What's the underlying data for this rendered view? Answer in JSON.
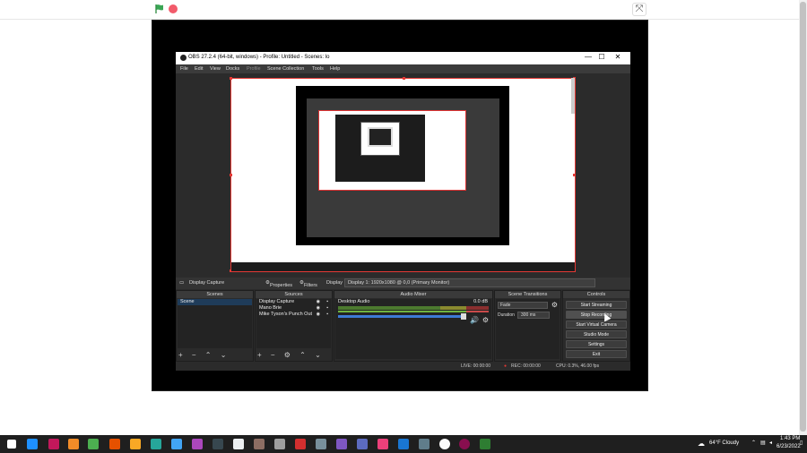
{
  "stage": {
    "fullscreen_glyph": "⤧"
  },
  "obs": {
    "title": "OBS 27.2.4 (64-bit, windows) - Profile: Untitled - Scenes: lo",
    "window_controls": [
      "—",
      "☐",
      "✕"
    ],
    "menu": [
      "File",
      "Edit",
      "View",
      "Docks",
      "Profile",
      "Scene Collection",
      "Tools",
      "Help"
    ],
    "source_toolbar": {
      "source_name": "Display Capture",
      "properties": "Properties",
      "filters": "Filters",
      "display_label": "Display",
      "display_value": "Display 1: 1920x1080 @ 0,0 (Primary Monitor)"
    },
    "docks": {
      "scenes": {
        "title": "Scenes",
        "items": [
          "Scene"
        ]
      },
      "sources": {
        "title": "Sources",
        "items": [
          "Display Capture",
          "Mano Brie",
          "Mike Tyson's Punch Out"
        ]
      },
      "mixer": {
        "title": "Audio Mixer",
        "channel": "Desktop Audio",
        "level": "0.0 dB"
      },
      "transitions": {
        "title": "Scene Transitions",
        "type": "Fade",
        "duration_label": "Duration",
        "duration_value": "300 ms"
      },
      "controls": {
        "title": "Controls",
        "buttons": [
          "Start Streaming",
          "Stop Recording",
          "Start Virtual Camera",
          "Studio Mode",
          "Settings",
          "Exit"
        ]
      }
    },
    "status": {
      "live": "LIVE: 00:00:00",
      "rec": "REC: 00:00:00",
      "cpu": "CPU: 0.3%, 46.00 fps"
    }
  },
  "taskbar": {
    "weather": "64°F  Cloudy",
    "time": "1:43 PM",
    "date": "6/23/2022"
  },
  "colors": {
    "accent_red": "#e53935",
    "obs_bg": "#2b2b2b",
    "flag_green": "#3aa655"
  }
}
